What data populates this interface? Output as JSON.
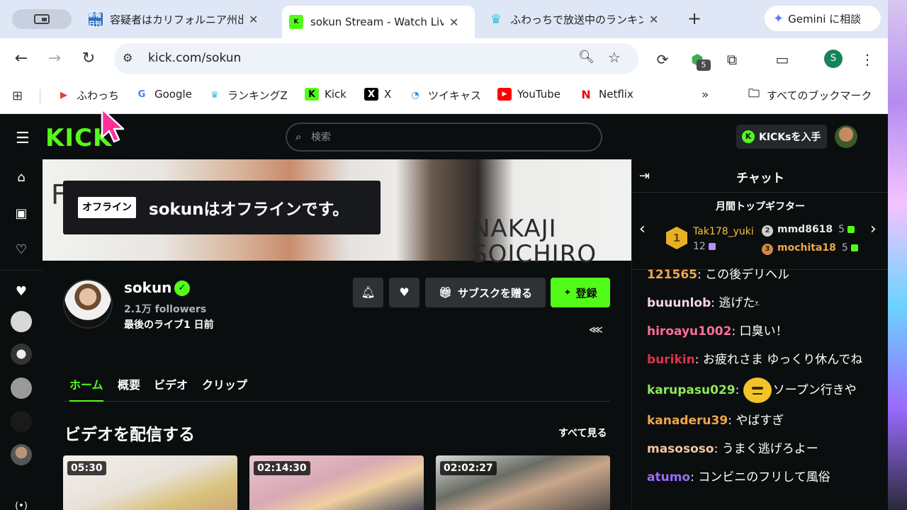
{
  "browser": {
    "tabs": [
      {
        "title": "容疑者はカリフォルニア州出",
        "favicon": "news-icon",
        "favicon_text": "新報日刊",
        "active": false
      },
      {
        "title": "sokun Stream - Watch Live",
        "favicon": "kick-icon",
        "favicon_text": "K",
        "active": true
      },
      {
        "title": "ふわっちで放送中のランキング",
        "favicon": "crown-icon",
        "favicon_text": "♛",
        "active": false
      }
    ],
    "gemini_label": "Gemini に相談",
    "url": "kick.com/sokun",
    "profile_initial": "S",
    "extension_badge": "5",
    "bookmarks": [
      {
        "label": "ふわっち",
        "icon": "play-icon"
      },
      {
        "label": "Google",
        "icon": "google-icon"
      },
      {
        "label": "ランキングZ",
        "icon": "crown-icon"
      },
      {
        "label": "Kick",
        "icon": "kick-icon"
      },
      {
        "label": "X",
        "icon": "x-icon"
      },
      {
        "label": "ツイキャス",
        "icon": "twitcasting-icon"
      },
      {
        "label": "YouTube",
        "icon": "youtube-icon"
      },
      {
        "label": "Netflix",
        "icon": "netflix-icon"
      }
    ],
    "all_bookmarks_label": "すべてのブックマーク"
  },
  "kick": {
    "logo": "KICK",
    "search_placeholder": "検索",
    "kicks_button": "KICKsを入手",
    "offline_badge": "オフライン",
    "offline_message": "sokunはオフラインです。",
    "banner_text": {
      "f": "F",
      "line1": "NAKAJI",
      "line2": "SOICHIRO"
    },
    "channel": {
      "name": "sokun",
      "followers": "2.1万 followers",
      "last_live": "最後のライブ1 日前"
    },
    "actions": {
      "gift_sub": "サブスクを贈る",
      "subscribe": "登録"
    },
    "tabs": [
      "ホーム",
      "概要",
      "ビデオ",
      "クリップ"
    ],
    "section_title": "ビデオを配信する",
    "see_all": "すべて見る",
    "videos": [
      {
        "duration": "05:30"
      },
      {
        "duration": "02:14:30"
      },
      {
        "duration": "02:02:27"
      }
    ]
  },
  "chat": {
    "title": "チャット",
    "gifters_title": "月間トップギフター",
    "gifters": [
      {
        "rank": "1",
        "name": "Tak178_yuki",
        "count": "12"
      },
      {
        "rank": "2",
        "name": "mmd8618",
        "count": "5"
      },
      {
        "rank": "3",
        "name": "mochita18",
        "count": "5"
      }
    ],
    "messages": [
      {
        "user": "121565",
        "color": "#f0a64b",
        "text": "この後デリヘル"
      },
      {
        "user": "buuunlob",
        "color": "#f3d4e6",
        "text": "逃げた"
      },
      {
        "user": "hiroayu1002",
        "color": "#ff6e9c",
        "text": "口臭い！"
      },
      {
        "user": "burikin",
        "color": "#e0324e",
        "text": "お疲れさま ゆっくり休んでね"
      },
      {
        "user": "karupasu029",
        "color": "#8fe85a",
        "text": "ソープン行きや",
        "emote": true
      },
      {
        "user": "kanaderu39",
        "color": "#f0a64b",
        "text": "やばすぎ"
      },
      {
        "user": "masososo",
        "color": "#f5c6a0",
        "text": "うまく逃げろよー"
      },
      {
        "user": "atumo",
        "color": "#9c6bff",
        "text": "コンビニのフリして風俗"
      }
    ]
  },
  "colors": {
    "kick_green": "#53fc18",
    "background": "#0b0e0f"
  }
}
